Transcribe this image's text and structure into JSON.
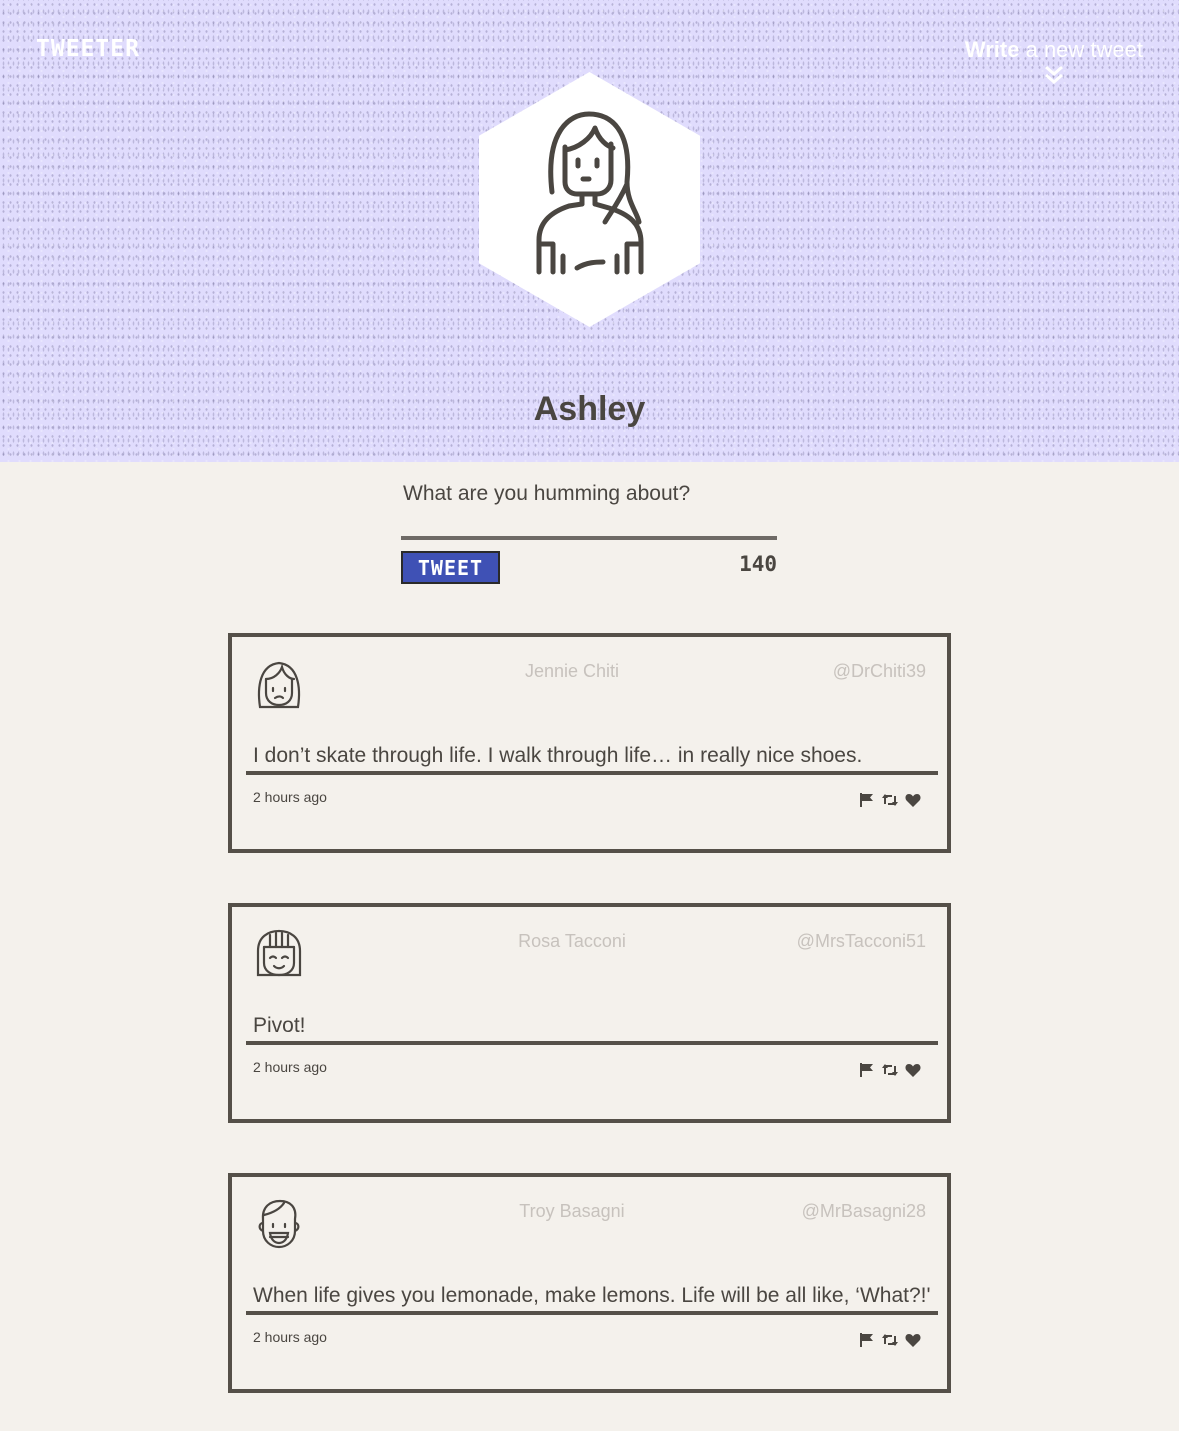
{
  "app": {
    "logo": "TWEETER",
    "compose_toggle_bold": "Write",
    "compose_toggle_rest": " a new tweet"
  },
  "profile": {
    "name": "Ashley"
  },
  "compose": {
    "placeholder": "What are you humming about?",
    "button_label": "TWEET",
    "char_count": "140"
  },
  "colors": {
    "header_bg": "#e0dcfd",
    "page_bg": "#f4f1ec",
    "button_bg": "#3f51b5",
    "border": "#555049"
  },
  "tweets": [
    {
      "name": "Jennie Chiti",
      "handle": "@DrChiti39",
      "text": "I don’t skate through life. I walk through life… in really nice shoes.",
      "time": "2 hours ago",
      "avatar": "woman-frowning-avatar-icon"
    },
    {
      "name": "Rosa Tacconi",
      "handle": "@MrsTacconi51",
      "text": "Pivot!",
      "time": "2 hours ago",
      "avatar": "woman-smiling-bangs-avatar-icon"
    },
    {
      "name": "Troy Basagni",
      "handle": "@MrBasagni28",
      "text": "When life gives you lemonade, make lemons. Life will be all like, ‘What?!'",
      "time": "2 hours ago",
      "avatar": "man-grinning-avatar-icon"
    }
  ]
}
